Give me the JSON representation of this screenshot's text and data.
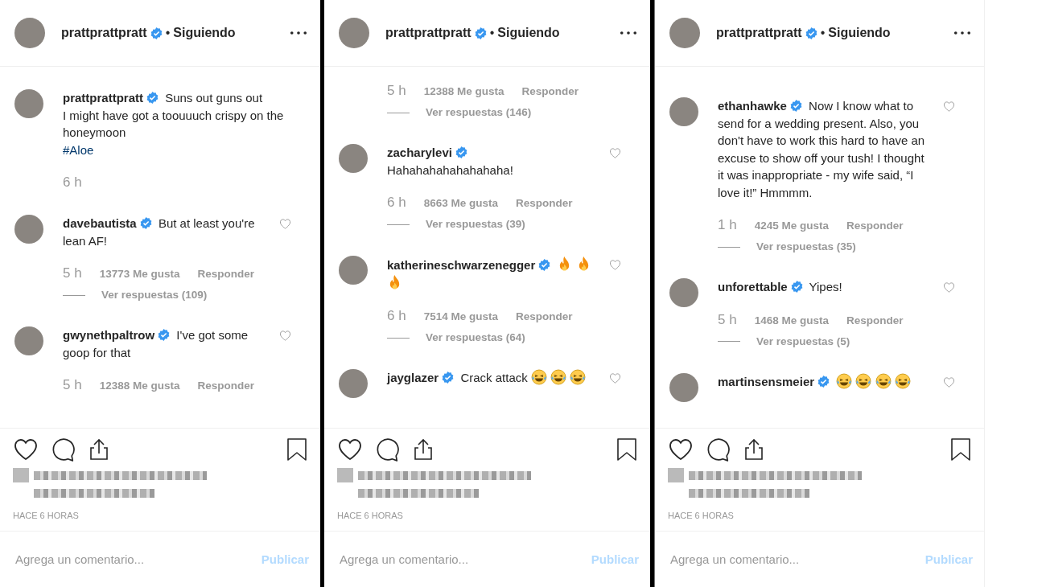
{
  "panels": [
    {
      "header": {
        "username": "prattprattpratt",
        "verified": true,
        "separator": "•",
        "follow": "Siguiendo"
      },
      "comments": [
        {
          "kind": "caption",
          "username": "prattprattpratt",
          "verified": true,
          "text": "Suns out guns out\nI might have got a toouuuch crispy on the honeymoon",
          "hashtag": "#Aloe",
          "time": "6 h"
        },
        {
          "kind": "comment",
          "username": "davebautista",
          "verified": true,
          "text": "But at least you're lean AF!",
          "time": "5 h",
          "likes": "13773 Me gusta",
          "reply": "Responder",
          "view_replies": "Ver respuestas (109)",
          "liked": false
        },
        {
          "kind": "comment",
          "username": "gwynethpaltrow",
          "verified": true,
          "text": "I've got some goop for that",
          "time": "5 h",
          "likes": "12388 Me gusta",
          "reply": "Responder",
          "liked": false
        }
      ],
      "likes_blurred": true,
      "timestamp": "HACE 6 HORAS",
      "comment_box": {
        "placeholder": "Agrega un comentario...",
        "button": "Publicar",
        "button_disabled": true
      }
    },
    {
      "header": {
        "username": "prattprattpratt",
        "verified": true,
        "separator": "•",
        "follow": "Siguiendo"
      },
      "comments": [
        {
          "kind": "meta",
          "time": "5 h",
          "likes": "12388 Me gusta",
          "reply": "Responder",
          "view_replies": "Ver respuestas (146)"
        },
        {
          "kind": "comment",
          "username": "zacharylevi",
          "verified": true,
          "text": "Hahahahahahahahaha!",
          "text_on_new_line": true,
          "time": "6 h",
          "likes": "8663 Me gusta",
          "reply": "Responder",
          "view_replies": "Ver respuestas (39)",
          "liked": false
        },
        {
          "kind": "comment",
          "username": "katherineschwarzenegger",
          "verified": true,
          "emojis": [
            {
              "kind": "fire"
            },
            {
              "kind": "fire"
            },
            {
              "kind": "fire"
            }
          ],
          "time": "6 h",
          "likes": "7514 Me gusta",
          "reply": "Responder",
          "view_replies": "Ver respuestas (64)",
          "liked": false
        },
        {
          "kind": "comment",
          "username": "jayglazer",
          "verified": true,
          "text": "Crack attack",
          "emojis": [
            {
              "kind": "laughing"
            },
            {
              "kind": "laughing"
            },
            {
              "kind": "laughing"
            }
          ],
          "liked": false
        }
      ],
      "likes_blurred": true,
      "timestamp": "HACE 6 HORAS",
      "comment_box": {
        "placeholder": "Agrega un comentario...",
        "button": "Publicar",
        "button_disabled": true
      }
    },
    {
      "header": {
        "username": "prattprattpratt",
        "verified": true,
        "separator": "•",
        "follow": "Siguiendo"
      },
      "comments": [
        {
          "kind": "comment",
          "username": "ethanhawke",
          "verified": true,
          "text": "Now I know what to send for a wedding present. Also, you don't have to work this hard to have an excuse to show off your tush! I thought it was inappropriate - my wife said, “I love it!” Hmmmm.",
          "time": "1 h",
          "likes": "4245 Me gusta",
          "reply": "Responder",
          "view_replies": "Ver respuestas (35)",
          "liked": false
        },
        {
          "kind": "comment",
          "username": "unforettable",
          "verified": true,
          "text": "Yipes!",
          "time": "5 h",
          "likes": "1468 Me gusta",
          "reply": "Responder",
          "view_replies": "Ver respuestas (5)",
          "liked": false
        },
        {
          "kind": "comment",
          "username": "martinsensmeier",
          "verified": true,
          "emojis": [
            {
              "kind": "laughing"
            },
            {
              "kind": "laughing"
            },
            {
              "kind": "laughing"
            },
            {
              "kind": "laughing"
            }
          ],
          "liked": false
        }
      ],
      "likes_blurred": true,
      "timestamp": "HACE 6 HORAS",
      "comment_box": {
        "placeholder": "Agrega un comentario...",
        "button": "Publicar",
        "button_disabled": true
      }
    }
  ]
}
